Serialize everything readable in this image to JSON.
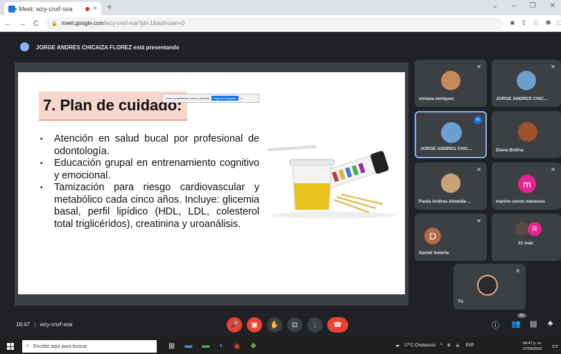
{
  "browser": {
    "tab_title": "Meet: wzy-cnxf-soa",
    "tab_close": "×",
    "new_tab": "+",
    "url_host": "meet.google.com",
    "url_path": "/wzy-cnxf-soa?pli=1&authuser=0",
    "win_min": "–",
    "win_restore": "❐",
    "win_close": "✕",
    "back": "←",
    "forward": "→",
    "reload": "C",
    "lock": "🔒"
  },
  "presenter_banner": {
    "text": "JORGE ANDRES CHICAIZA FLOREZ está presentando"
  },
  "slide": {
    "title": "7. Plan de cuidado:",
    "share_notice": "Está compartiendo toda su pantalla",
    "share_stop": "Dejar de compartir",
    "bullets": [
      "Atención en salud bucal por profesional de odontología.",
      "Educación grupal en entrenamiento cognitivo y emocional.",
      "Tamización para riesgo cardiovascular y metabólico cada cinco años. Incluye: glicemia basal, perfil lipídico (HDL, LDL, colesterol total triglicéridos), creatinina y uroanálisis."
    ]
  },
  "participants": [
    {
      "name": "viviana enriquez",
      "avatar_color": "#c48a5a"
    },
    {
      "name": "JORGE ANDRES CHIC...",
      "avatar_color": "#6b9fd0"
    },
    {
      "name": "JORGE ANDRES CHIC...",
      "avatar_color": "#6b9fd0",
      "active": true
    },
    {
      "name": "Diana Botina",
      "avatar_color": "#a0522d"
    },
    {
      "name": "Paola Andrea Almeida ...",
      "avatar_color": "#c9a27a"
    },
    {
      "name": "marino ceron meneses",
      "letter": "m",
      "avatar_color": "#e52592"
    },
    {
      "name": "Daniel Solarte",
      "letter": "D",
      "avatar_color": "#b26a4b"
    },
    {
      "name": "21 más",
      "letter": "R",
      "avatar_color": "#e52592"
    },
    {
      "name": "Tú",
      "avatar_color": "#2b2b2b"
    }
  ],
  "bottombar": {
    "time": "16:47",
    "separator": "|",
    "meeting_code": "wzy-cnxf-soa",
    "participant_count": "30"
  },
  "taskbar": {
    "search_placeholder": "Escribe aquí para buscar",
    "weather": "17°C  Chubascos",
    "lang": "ESP",
    "time": "04:47 p. m.",
    "date": "27/04/2022"
  },
  "colors": {
    "meet_bg": "#202124",
    "tile_bg": "#3c4043",
    "accent": "#1a73e8",
    "hangup": "#ea4335"
  }
}
